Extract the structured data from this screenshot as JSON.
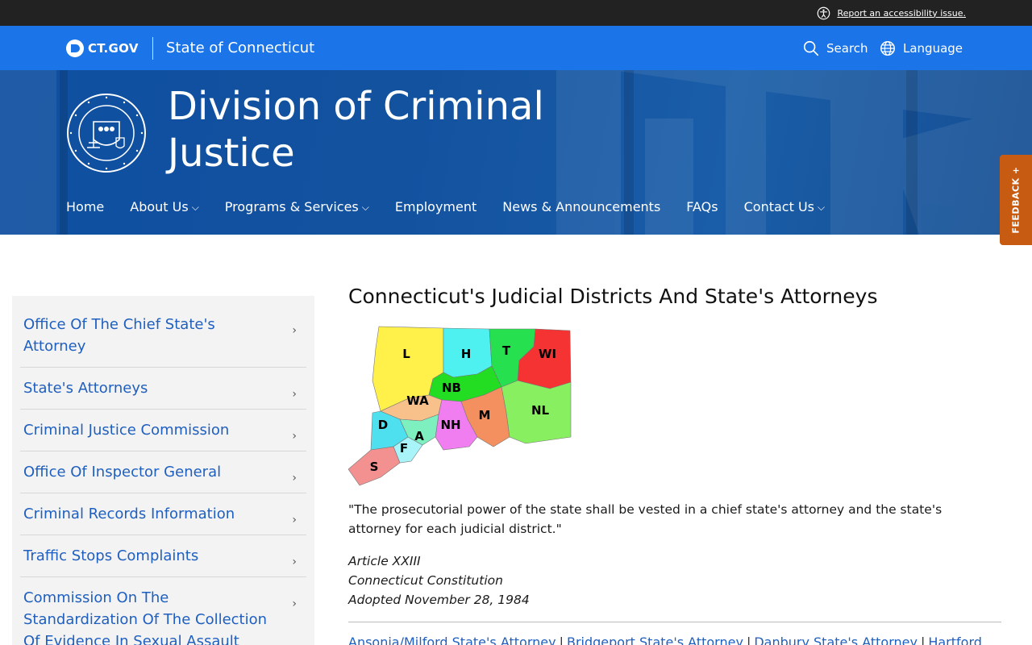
{
  "utility": {
    "accessibility_label": "Report an accessibility issue."
  },
  "ctbar": {
    "logo_text": "CT.GOV",
    "state_name": "State of Connecticut",
    "search_label": "Search",
    "language_label": "Language"
  },
  "hero": {
    "title": "Division of Criminal Justice"
  },
  "nav": [
    {
      "label": "Home",
      "has_menu": false
    },
    {
      "label": "About Us",
      "has_menu": true
    },
    {
      "label": "Programs & Services",
      "has_menu": true
    },
    {
      "label": "Employment",
      "has_menu": false
    },
    {
      "label": "News & Announcements",
      "has_menu": false
    },
    {
      "label": "FAQs",
      "has_menu": false
    },
    {
      "label": "Contact Us",
      "has_menu": true
    }
  ],
  "feedback": {
    "label": "FEEDBACK +"
  },
  "sidebar": {
    "items": [
      {
        "label": "Office Of The Chief State's Attorney"
      },
      {
        "label": "State's Attorneys"
      },
      {
        "label": "Criminal Justice Commission"
      },
      {
        "label": "Office Of Inspector General"
      },
      {
        "label": "Criminal Records Information"
      },
      {
        "label": "Traffic Stops Complaints"
      },
      {
        "label": "Commission On The Standardization Of The Collection Of Evidence In Sexual Assault"
      }
    ]
  },
  "content": {
    "title": "Connecticut's Judicial Districts And State's Attorneys",
    "quote": "\"The prosecutorial power of the state shall be vested in a chief state's attorney and the state's attorney for each judicial district.\"",
    "citation": [
      "Article XXIII",
      "Connecticut Constitution",
      "Adopted November 28, 1984"
    ],
    "links": [
      "Ansonia/Milford State's Attorney",
      "Bridgeport State's Attorney",
      "Danbury State's Attorney",
      "Hartford"
    ]
  },
  "map": {
    "districts": [
      {
        "code": "L",
        "color": "#fff04a"
      },
      {
        "code": "H",
        "color": "#4ff0f0"
      },
      {
        "code": "T",
        "color": "#27e04f"
      },
      {
        "code": "WI",
        "color": "#f53333"
      },
      {
        "code": "NB",
        "color": "#22dd22"
      },
      {
        "code": "WA",
        "color": "#f8c08a"
      },
      {
        "code": "NL",
        "color": "#88f060"
      },
      {
        "code": "M",
        "color": "#f49060"
      },
      {
        "code": "D",
        "color": "#4fe0f0"
      },
      {
        "code": "NH",
        "color": "#f07ef0"
      },
      {
        "code": "A",
        "color": "#7ef0c0"
      },
      {
        "code": "F",
        "color": "#a8f4f8"
      },
      {
        "code": "S",
        "color": "#f39090"
      }
    ]
  }
}
